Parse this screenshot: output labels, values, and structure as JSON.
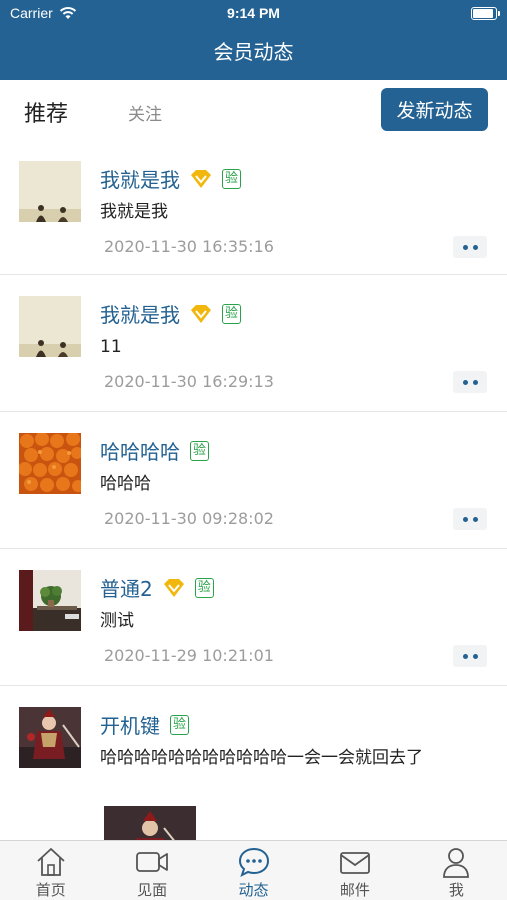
{
  "status_bar": {
    "carrier": "Carrier",
    "time": "9:14 PM"
  },
  "header": {
    "title": "会员动态"
  },
  "tabs": {
    "recommend": "推荐",
    "follow": "关注",
    "new_post": "发新动态"
  },
  "posts": [
    {
      "name": "我就是我",
      "vip": true,
      "verify": "验",
      "content": "我就是我",
      "time": "2020-11-30 16:35:16"
    },
    {
      "name": "我就是我",
      "vip": true,
      "verify": "验",
      "content": "11",
      "time": "2020-11-30 16:29:13"
    },
    {
      "name": "哈哈哈哈",
      "vip": false,
      "verify": "验",
      "content": "哈哈哈",
      "time": "2020-11-30 09:28:02"
    },
    {
      "name": "普通2",
      "vip": true,
      "verify": "验",
      "content": "测试",
      "time": "2020-11-29 10:21:01"
    },
    {
      "name": "开机键",
      "vip": false,
      "verify": "验",
      "content": "哈哈哈哈哈哈哈哈哈哈哈一会一会就回去了"
    }
  ],
  "tabbar": [
    {
      "label": "首页",
      "icon": "home-icon"
    },
    {
      "label": "见面",
      "icon": "video-icon"
    },
    {
      "label": "动态",
      "icon": "chat-icon",
      "active": true
    },
    {
      "label": "邮件",
      "icon": "mail-icon"
    },
    {
      "label": "我",
      "icon": "person-icon"
    }
  ],
  "colors": {
    "brand": "#236292",
    "verify": "#2aa24a",
    "vip": "#f2b70c",
    "time": "#9c9c9c"
  }
}
